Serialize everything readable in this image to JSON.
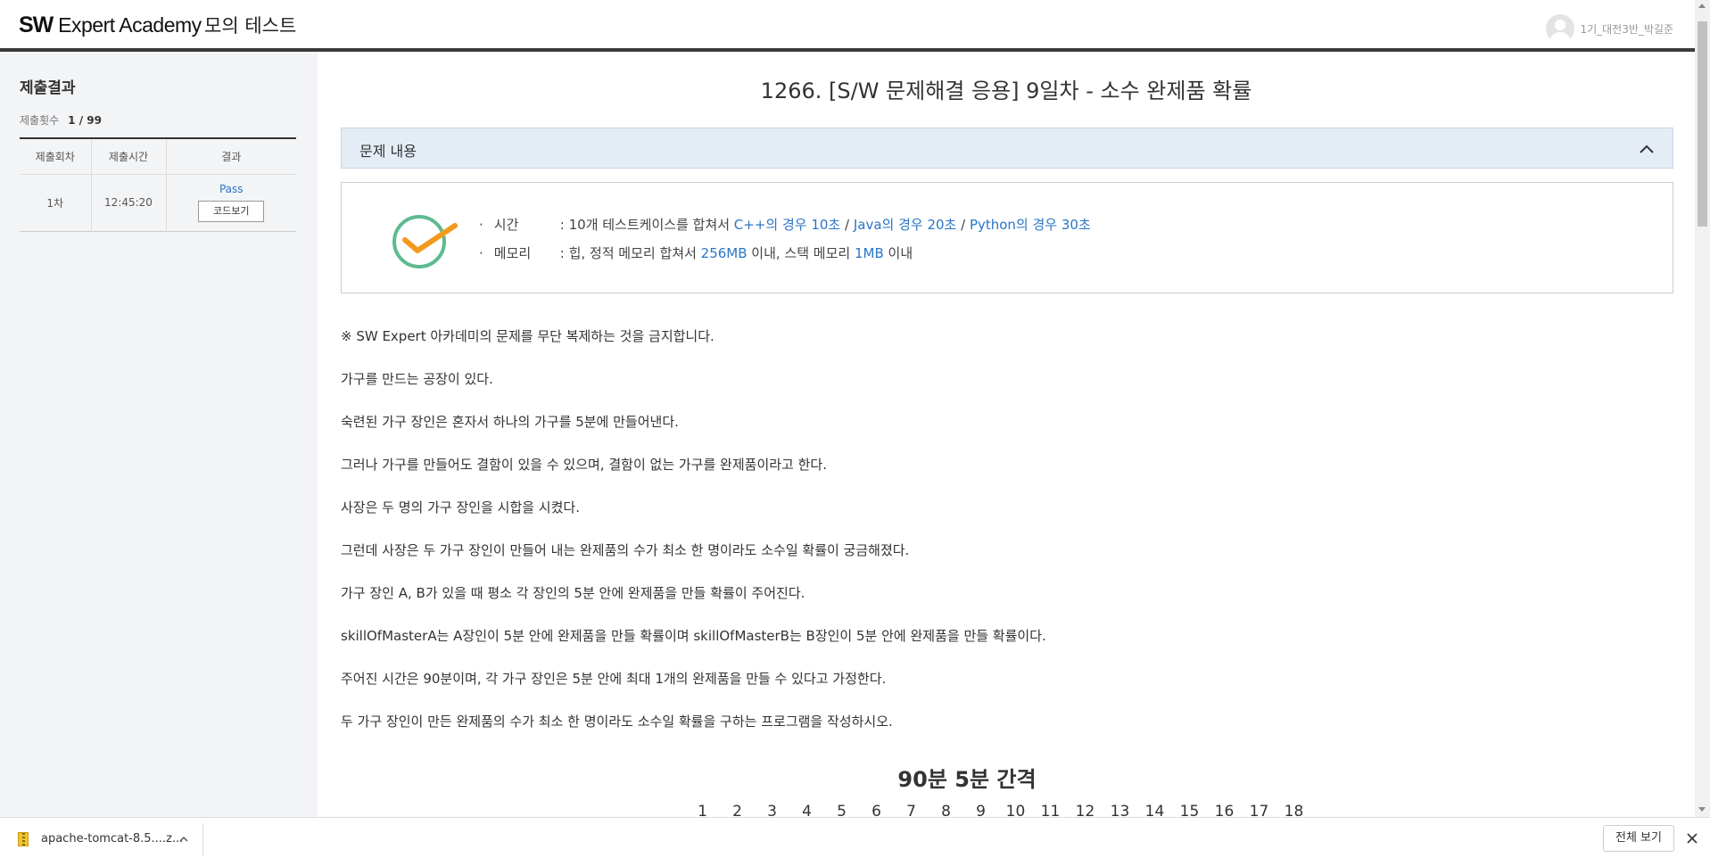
{
  "header": {
    "logo_bold": "SW",
    "logo_rest": " Expert Academy",
    "mode_title": "모의 테스트",
    "user_name": "1기_대전3반_박길준"
  },
  "sidebar": {
    "title": "제출결과",
    "count_label": "제출횟수",
    "count_value": "1 / 99",
    "columns": [
      "제출회차",
      "제출시간",
      "결과"
    ],
    "rows": [
      {
        "round": "1차",
        "time": "12:45:20",
        "result": "Pass",
        "code_button": "코드보기"
      }
    ]
  },
  "problem": {
    "title": "1266. [S/W 문제해결 응용] 9일차 - 소수 완제품 확률",
    "section_label": "문제 내용",
    "limits": {
      "bullet": "·",
      "time_key": "시간",
      "time_prefix": ": 10개 테스트케이스를 합쳐서 ",
      "time_cpp": "C++의 경우 10초",
      "sep1": " / ",
      "time_java": "Java의 경우 20초",
      "sep2": " / ",
      "time_python": "Python의 경우 30초",
      "memory_key": "메모리",
      "memory_prefix": ": 힙, 정적 메모리 합쳐서 ",
      "memory_heap": "256MB",
      "memory_mid": " 이내, 스택 메모리 ",
      "memory_stack": "1MB",
      "memory_suffix": " 이내"
    },
    "paragraphs": [
      "※ SW Expert 아카데미의 문제를 무단 복제하는 것을 금지합니다.",
      "가구를 만드는 공장이 있다.",
      "숙련된 가구 장인은 혼자서 하나의 가구를 5분에 만들어낸다.",
      "그러나 가구를 만들어도 결함이 있을 수 있으며, 결함이 없는 가구를 완제품이라고 한다.",
      "사장은 두 명의 가구 장인을 시합을 시켰다.",
      "그런데 사장은 두 가구 장인이 만들어 내는 완제품의 수가 최소 한 명이라도 소수일 확률이 궁금해졌다.",
      "가구 장인 A, B가 있을 때 평소 각 장인의 5분 안에 완제품을 만들 확률이 주어진다.",
      "skillOfMasterA는 A장인이 5분 안에 완제품을 만들 확률이며 skillOfMasterB는 B장인이 5분 안에 완제품을 만들 확률이다.",
      "주어진 시간은 90분이며, 각 가구 장인은 5분 안에 최대 1개의 완제품을 만들 수 있다고 가정한다.",
      "두 가구 장인이 만든 완제품의 수가 최소 한 명이라도 소수일 확률을 구하는 프로그램을 작성하시오."
    ],
    "figure_title": "90분 5분 간격",
    "figure_numbers": [
      "1",
      "2",
      "3",
      "4",
      "5",
      "6",
      "7",
      "8",
      "9",
      "10",
      "11",
      "12",
      "13",
      "14",
      "15",
      "16",
      "17",
      "18"
    ]
  },
  "download_bar": {
    "file_name": "apache-tomcat-8.5....z...",
    "show_all": "전체 보기"
  },
  "colors": {
    "link_blue": "#2a76c6",
    "sidebar_bg": "#f3f4f6",
    "collapse_bg": "#e4edf6",
    "check_green": "#5dbb8f",
    "check_orange": "#f29a1d"
  }
}
